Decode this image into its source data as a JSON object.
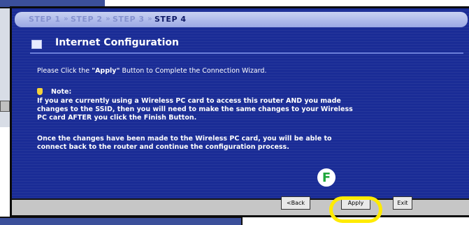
{
  "steps": [
    {
      "label": "STEP 1"
    },
    {
      "label": "STEP 2"
    },
    {
      "label": "STEP 3"
    },
    {
      "label": "STEP 4"
    }
  ],
  "step_separator": "»",
  "title": "Internet Configuration",
  "instruction": {
    "prefix": "Please Click the ",
    "bold": "\"Apply\"",
    "suffix": " Button to Complete the Connection Wizard."
  },
  "note": {
    "label": "Note:",
    "line1": "If you are currently using a Wireless PC card to access this router AND you made",
    "line2": "changes to the SSID, then you will need to make the same changes to your Wireless",
    "line3": "PC card AFTER you click the Finish Button.",
    "line4": "Once the changes have been made to the Wireless PC card, you will be able to",
    "line5": "connect back to the router and continue the configuration process."
  },
  "buttons": {
    "back": "<Back",
    "apply": "Apply",
    "exit": "Exit"
  },
  "callout": "F",
  "colors": {
    "panel": "#1a2c96",
    "highlight": "#ffeb00",
    "callout": "#1fa63a"
  }
}
